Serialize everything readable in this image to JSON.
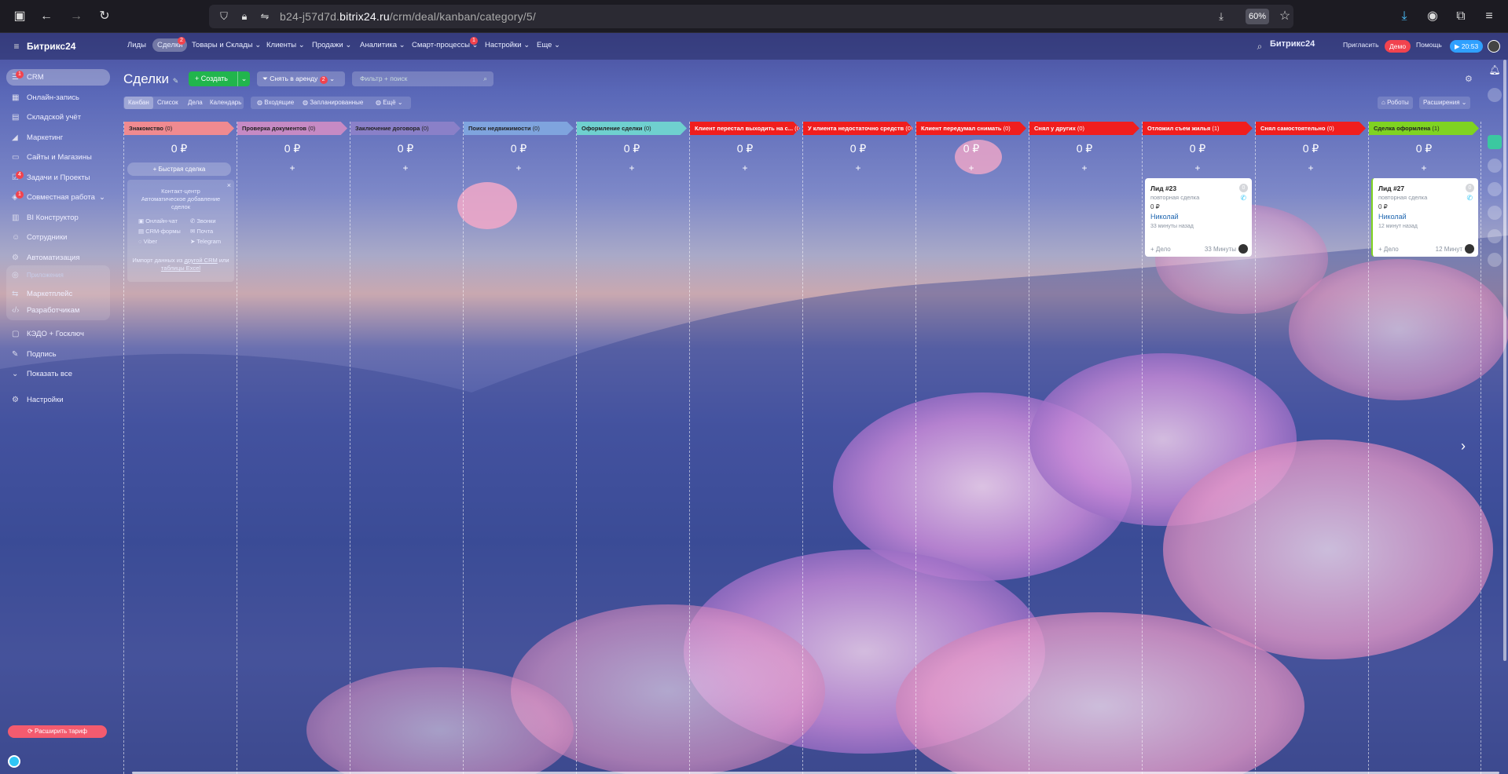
{
  "browser": {
    "url_prefix": "b24-j57d7d.",
    "url_domain": "bitrix24.ru",
    "url_path": "/crm/deal/kanban/category/5/",
    "zoom": "60%"
  },
  "topbar": {
    "logo": "Битрикс24",
    "nav": [
      {
        "label": "Лиды"
      },
      {
        "label": "Сделки",
        "badge": "2"
      },
      {
        "label": "Товары и Склады ⌄"
      },
      {
        "label": "Клиенты ⌄"
      },
      {
        "label": "Продажи ⌄"
      },
      {
        "label": "Аналитика ⌄"
      },
      {
        "label": "Смарт-процессы ⌄",
        "badge": "1"
      },
      {
        "label": "Настройки ⌄"
      },
      {
        "label": "Еще ⌄"
      }
    ],
    "brand_right": "Битрикс24",
    "invite": "Пригласить",
    "demo": "Демо",
    "help": "Помощь",
    "clock": "20:53"
  },
  "sidebar": {
    "items": [
      {
        "label": "CRM",
        "icon": "filter-icon",
        "badge": "1"
      },
      {
        "label": "Онлайн-запись",
        "icon": "calendar-icon"
      },
      {
        "label": "Складской учёт",
        "icon": "warehouse-icon"
      },
      {
        "label": "Маркетинг",
        "icon": "megaphone-icon"
      },
      {
        "label": "Сайты и Магазины",
        "icon": "sites-icon"
      },
      {
        "label": "Задачи и Проекты",
        "icon": "tasks-icon",
        "badge": "4"
      },
      {
        "label": "Совместная работа",
        "icon": "collab-icon",
        "badge": "1"
      },
      {
        "label": "BI Конструктор",
        "icon": "bi-icon"
      },
      {
        "label": "Сотрудники",
        "icon": "users-icon"
      },
      {
        "label": "Автоматизация",
        "icon": "automation-icon"
      }
    ],
    "apps_section": "Приложения",
    "apps": [
      {
        "label": "Маркетплейс"
      },
      {
        "label": "Разработчикам"
      }
    ],
    "more": [
      {
        "label": "КЭДО + Госключ"
      },
      {
        "label": "Подпись"
      },
      {
        "label": "Показать все"
      },
      {
        "label": "Настройки"
      }
    ],
    "upgrade": "Расширить тариф"
  },
  "page": {
    "title": "Сделки",
    "create": "Создать",
    "pipeline": "Снять в аренду",
    "pipeline_badge": "2",
    "search_placeholder": "Фильтр + поиск",
    "views": [
      "Канбан",
      "Список",
      "Дела",
      "Календарь"
    ],
    "activity": [
      "Входящие",
      "Запланированные",
      "Ещё"
    ],
    "robots": "Роботы",
    "extensions": "Расширения"
  },
  "columns": [
    {
      "title": "Знакомство",
      "count": "(0)",
      "sum": "0 ₽",
      "color": "#f08a90",
      "text": "#222"
    },
    {
      "title": "Проверка документов",
      "count": "(0)",
      "sum": "0 ₽",
      "color": "#c68ac4",
      "text": "#222"
    },
    {
      "title": "Заключение договора",
      "count": "(0)",
      "sum": "0 ₽",
      "color": "#8a80c8",
      "text": "#222"
    },
    {
      "title": "Поиск недвижимости",
      "count": "(0)",
      "sum": "0 ₽",
      "color": "#7fa4de",
      "text": "#222"
    },
    {
      "title": "Оформление сделки",
      "count": "(0)",
      "sum": "0 ₽",
      "color": "#6fd0cf",
      "text": "#222"
    },
    {
      "title": "Клиент перестал выходить на с...",
      "count": "(0)",
      "sum": "0 ₽",
      "color": "#f01e1e",
      "text": "#fff"
    },
    {
      "title": "У клиента недостаточно средств",
      "count": "(0)",
      "sum": "0 ₽",
      "color": "#f01e1e",
      "text": "#fff"
    },
    {
      "title": "Клиент передумал снимать",
      "count": "(0)",
      "sum": "0 ₽",
      "color": "#f01e1e",
      "text": "#fff"
    },
    {
      "title": "Снял у других",
      "count": "(0)",
      "sum": "0 ₽",
      "color": "#f01e1e",
      "text": "#fff"
    },
    {
      "title": "Отложил съем жилья",
      "count": "(1)",
      "sum": "0 ₽",
      "color": "#f01e1e",
      "text": "#fff"
    },
    {
      "title": "Снял самостоятельно",
      "count": "(0)",
      "sum": "0 ₽",
      "color": "#f01e1e",
      "text": "#fff"
    },
    {
      "title": "Сделка оформлена",
      "count": "(1)",
      "sum": "0 ₽",
      "color": "#7fd321",
      "text": "#222"
    }
  ],
  "quick_deal": "Быстрая сделка",
  "contact_center": {
    "title": "Контакт-центр",
    "subtitle": "Автоматическое добавление сделок",
    "channels": [
      "Онлайн-чат",
      "Звонки",
      "CRM-формы",
      "Почта",
      "Viber",
      "Telegram"
    ],
    "import_text": "Импорт данных из",
    "import_link1": "другой CRM",
    "import_or": "или",
    "import_link2": "таблицы Excel"
  },
  "cards": [
    {
      "title": "Лид #23",
      "subtitle": "повторная сделка",
      "price": "0 ₽",
      "name": "Николай",
      "date": "33 минуты назад",
      "add": "+ Дело",
      "time": "33 Минуты",
      "counter": "0"
    },
    {
      "title": "Лид #27",
      "subtitle": "повторная сделка",
      "price": "0 ₽",
      "name": "Николай",
      "date": "12 минут назад",
      "add": "+ Дело",
      "time": "12 Минут",
      "counter": "0"
    }
  ]
}
